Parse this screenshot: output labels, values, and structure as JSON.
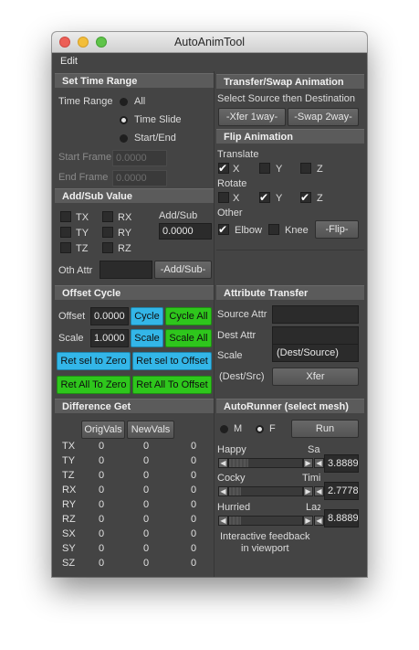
{
  "window": {
    "title": "AutoAnimTool"
  },
  "menu": {
    "edit": "Edit"
  },
  "time_range": {
    "header": "Set Time Range",
    "label": "Time Range",
    "options": [
      "All",
      "Time Slide",
      "Start/End"
    ],
    "selected": "Time Slide",
    "start_label": "Start Frame",
    "start_value": "0.0000",
    "end_label": "End Frame",
    "end_value": "0.0000"
  },
  "add_sub": {
    "header": "Add/Sub Value",
    "attrs": [
      "TX",
      "TY",
      "TZ",
      "RX",
      "RY",
      "RZ"
    ],
    "value_label": "Add/Sub",
    "value": "0.0000",
    "oth_attr_label": "Oth Attr",
    "oth_attr_value": "",
    "button": "-Add/Sub-"
  },
  "transfer_swap": {
    "header": "Transfer/Swap Animation",
    "instruction": "Select Source then Destination",
    "xfer_button": "-Xfer 1way-",
    "swap_button": "-Swap 2way-"
  },
  "flip": {
    "header": "Flip Animation",
    "translate_label": "Translate",
    "rotate_label": "Rotate",
    "other_label": "Other",
    "axes": [
      "X",
      "Y",
      "Z"
    ],
    "translate_checked": [
      true,
      false,
      false
    ],
    "rotate_checked": [
      false,
      true,
      true
    ],
    "elbow_label": "Elbow",
    "elbow_checked": true,
    "knee_label": "Knee",
    "knee_checked": false,
    "button": "-Flip-"
  },
  "offset_cycle": {
    "header": "Offset Cycle",
    "offset_label": "Offset",
    "offset_value": "0.0000",
    "scale_label": "Scale",
    "scale_value": "1.0000",
    "cycle_button": "Cycle",
    "cycle_all_button": "Cycle All",
    "scale_button": "Scale",
    "scale_all_button": "Scale All",
    "ret_sel_zero": "Ret sel to Zero",
    "ret_sel_offset": "Ret sel to Offset",
    "ret_all_zero": "Ret All To Zero",
    "ret_all_offset": "Ret All To Offset"
  },
  "attr_transfer": {
    "header": "Attribute Transfer",
    "source_label": "Source Attr",
    "source_value": "",
    "dest_label": "Dest Attr",
    "dest_value": "",
    "scale_label": "Scale",
    "scale_value": "(Dest/Source)",
    "ratio_label": "(Dest/Src)",
    "button": "Xfer"
  },
  "diff_get": {
    "header": "Difference Get",
    "orig_button": "OrigVals",
    "new_button": "NewVals",
    "rows": [
      {
        "attr": "TX",
        "orig": "0",
        "new": "0",
        "diff": "0"
      },
      {
        "attr": "TY",
        "orig": "0",
        "new": "0",
        "diff": "0"
      },
      {
        "attr": "TZ",
        "orig": "0",
        "new": "0",
        "diff": "0"
      },
      {
        "attr": "RX",
        "orig": "0",
        "new": "0",
        "diff": "0"
      },
      {
        "attr": "RY",
        "orig": "0",
        "new": "0",
        "diff": "0"
      },
      {
        "attr": "RZ",
        "orig": "0",
        "new": "0",
        "diff": "0"
      },
      {
        "attr": "SX",
        "orig": "0",
        "new": "0",
        "diff": "0"
      },
      {
        "attr": "SY",
        "orig": "0",
        "new": "0",
        "diff": "0"
      },
      {
        "attr": "SZ",
        "orig": "0",
        "new": "0",
        "diff": "0"
      }
    ]
  },
  "autorunner": {
    "header": "AutoRunner (select mesh)",
    "m_label": "M",
    "f_label": "F",
    "selected_gender": "F",
    "run_button": "Run",
    "sliders": [
      {
        "left": "Happy",
        "right": "Sad",
        "value": "3.8889",
        "level": 0.26
      },
      {
        "left": "Cocky",
        "right": "Timid",
        "value": "2.7778",
        "level": 0.16
      },
      {
        "left": "Hurried",
        "right": "Lazy",
        "value": "8.8889",
        "level": 0.16
      }
    ],
    "feedback_line1": "Interactive feedback",
    "feedback_line2": "in viewport"
  }
}
